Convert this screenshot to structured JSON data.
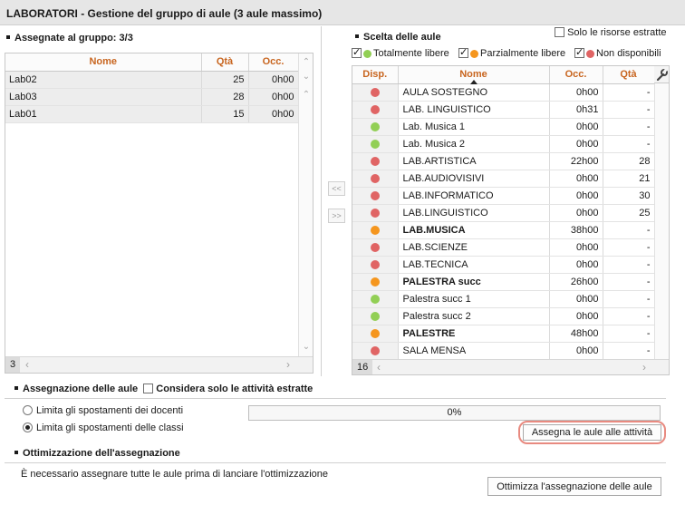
{
  "window": {
    "title": "LABORATORI - Gestione del gruppo di aule (3 aule massimo)"
  },
  "left": {
    "title": "Assegnate al gruppo: 3/3",
    "columns": [
      "Nome",
      "Qtà",
      "Occ."
    ],
    "rows": [
      {
        "nome": "Lab02",
        "qta": "25",
        "occ": "0h00"
      },
      {
        "nome": "Lab03",
        "qta": "28",
        "occ": "0h00"
      },
      {
        "nome": "Lab01",
        "qta": "15",
        "occ": "0h00"
      }
    ],
    "count": "3"
  },
  "transfer": {
    "add_label": "<<",
    "remove_label": ">>"
  },
  "right": {
    "title": "Scelta delle aule",
    "only_extracted_label": "Solo le risorse estratte",
    "legend": {
      "free_label": "Totalmente libere",
      "partial_label": "Parzialmente libere",
      "busy_label": "Non disponibili"
    },
    "columns": [
      "Disp.",
      "Nome",
      "Occ.",
      "Qtà"
    ],
    "rows": [
      {
        "disp": "red",
        "nome": "AULA SOSTEGNO",
        "occ": "0h00",
        "qta": "-",
        "bold": false
      },
      {
        "disp": "red",
        "nome": "LAB. LINGUISTICO",
        "occ": "0h31",
        "qta": "-",
        "bold": false
      },
      {
        "disp": "green",
        "nome": "Lab. Musica 1",
        "occ": "0h00",
        "qta": "-",
        "bold": false
      },
      {
        "disp": "green",
        "nome": "Lab. Musica 2",
        "occ": "0h00",
        "qta": "-",
        "bold": false
      },
      {
        "disp": "red",
        "nome": "LAB.ARTISTICA",
        "occ": "22h00",
        "qta": "28",
        "bold": false
      },
      {
        "disp": "red",
        "nome": "LAB.AUDIOVISIVI",
        "occ": "0h00",
        "qta": "21",
        "bold": false
      },
      {
        "disp": "red",
        "nome": "LAB.INFORMATICO",
        "occ": "0h00",
        "qta": "30",
        "bold": false
      },
      {
        "disp": "red",
        "nome": "LAB.LINGUISTICO",
        "occ": "0h00",
        "qta": "25",
        "bold": false
      },
      {
        "disp": "orange",
        "nome": "LAB.MUSICA",
        "occ": "38h00",
        "qta": "-",
        "bold": true
      },
      {
        "disp": "red",
        "nome": "LAB.SCIENZE",
        "occ": "0h00",
        "qta": "-",
        "bold": false
      },
      {
        "disp": "red",
        "nome": "LAB.TECNICA",
        "occ": "0h00",
        "qta": "-",
        "bold": false
      },
      {
        "disp": "orange",
        "nome": "PALESTRA succ",
        "occ": "26h00",
        "qta": "-",
        "bold": true
      },
      {
        "disp": "green",
        "nome": "Palestra succ 1",
        "occ": "0h00",
        "qta": "-",
        "bold": false
      },
      {
        "disp": "green",
        "nome": "Palestra succ 2",
        "occ": "0h00",
        "qta": "-",
        "bold": false
      },
      {
        "disp": "orange",
        "nome": "PALESTRE",
        "occ": "48h00",
        "qta": "-",
        "bold": true
      },
      {
        "disp": "red",
        "nome": "SALA MENSA",
        "occ": "0h00",
        "qta": "-",
        "bold": false
      }
    ],
    "count": "16"
  },
  "assign": {
    "title": "Assegnazione delle aule",
    "only_extracted_label": "Considera solo le attività estratte",
    "option_teachers": "Limita gli spostamenti dei docenti",
    "option_classes": "Limita gli spostamenti delle classi",
    "progress_percent": 0,
    "progress_label": "0%",
    "assign_button": "Assegna le aule alle attività"
  },
  "optim": {
    "title": "Ottimizzazione dell'assegnazione",
    "message": "È necessario assegnare tutte le aule prima di lanciare l'ottimizzazione",
    "button": "Ottimizza l'assegnazione delle aule"
  },
  "colors": {
    "red": "#e06464",
    "green": "#92cf55",
    "orange": "#f5961e",
    "header_text": "#c8651f",
    "highlight": "#e88a80"
  },
  "icons": {
    "settings": "wrench-icon",
    "sort": "sort-arrow-icon"
  }
}
